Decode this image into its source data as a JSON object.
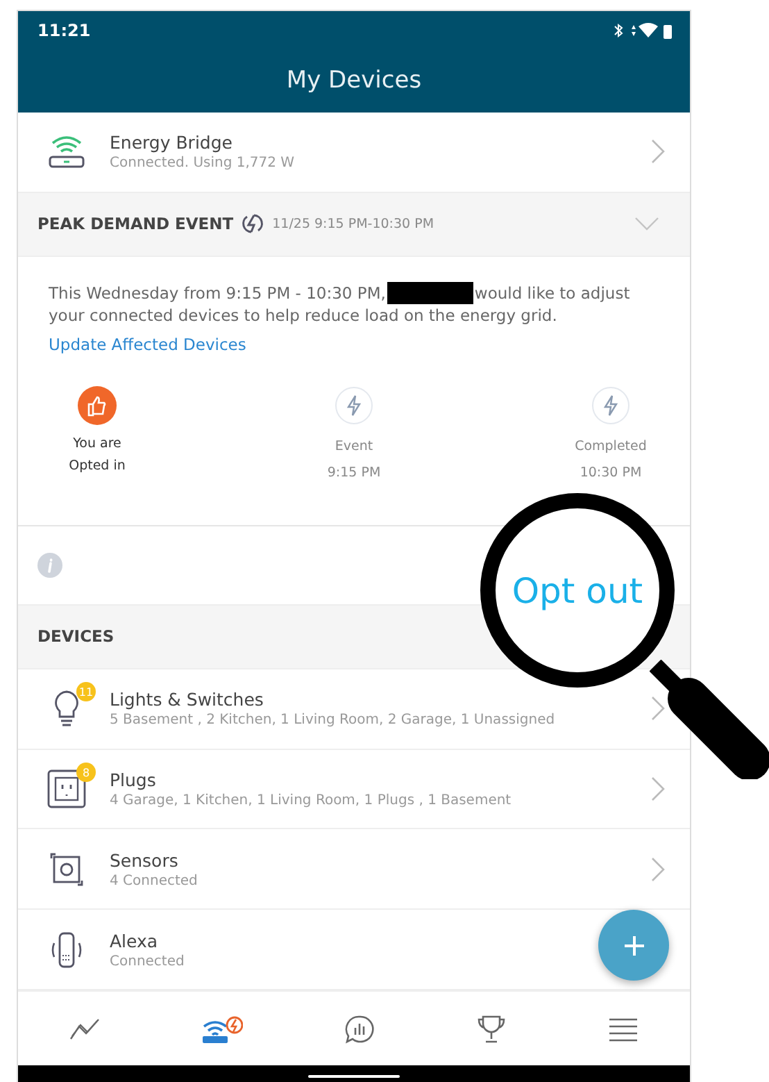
{
  "status_bar": {
    "time": "11:21"
  },
  "header": {
    "title": "My Devices"
  },
  "energy_bridge": {
    "name": "Energy Bridge",
    "status": "Connected. Using 1,772 W"
  },
  "peak_event": {
    "title": "PEAK DEMAND EVENT",
    "when": "11/25 9:15 PM-10:30 PM",
    "expanded": true,
    "message_start": "This Wednesday from 9:15 PM - 10:30 PM,",
    "message_middle": "would like to adjust",
    "message_end": "your connected devices to help reduce load on the energy grid.",
    "link": "Update Affected Devices",
    "stages": [
      {
        "kind": "done",
        "lines": [
          "You are",
          "Opted in"
        ]
      },
      {
        "kind": "pending",
        "lines": [
          "Event",
          "9:15 PM"
        ]
      },
      {
        "kind": "pending",
        "lines": [
          "Completed",
          "10:30 PM"
        ]
      }
    ],
    "action": "Opt out"
  },
  "devices": {
    "title": "DEVICES",
    "items": [
      {
        "kind": "bulb",
        "name": "Lights & Switches",
        "detail": "5 Basement , 2 Kitchen, 1 Living Room, 2 Garage, 1 Unassigned",
        "badge": "11"
      },
      {
        "kind": "plug",
        "name": "Plugs",
        "detail": "4 Garage, 1 Kitchen, 1 Living Room, 1 Plugs , 1 Basement",
        "badge": "8"
      },
      {
        "kind": "sensor",
        "name": "Sensors",
        "detail": "4 Connected"
      },
      {
        "kind": "speaker",
        "name": "Alexa",
        "detail": "Connected"
      }
    ]
  },
  "nav": [
    {
      "kind": "usage",
      "selected": false
    },
    {
      "kind": "devices",
      "selected": true
    },
    {
      "kind": "messages",
      "selected": false
    },
    {
      "kind": "trophy",
      "selected": false
    },
    {
      "kind": "menu",
      "selected": false
    }
  ]
}
